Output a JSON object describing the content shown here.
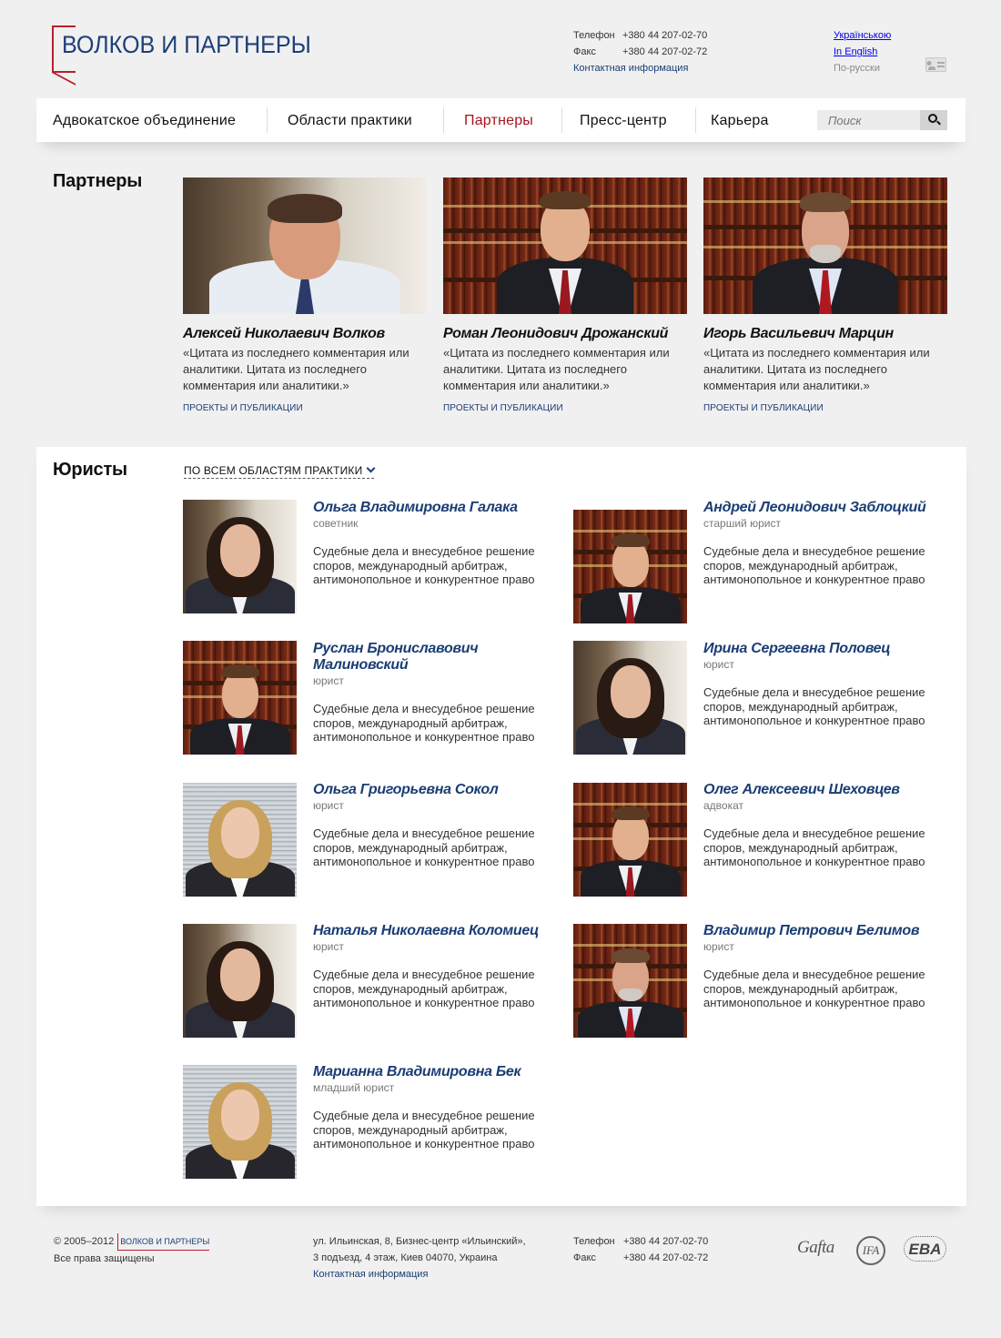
{
  "header": {
    "logo_text": "ВОЛКОВ И ПАРТНЕРЫ",
    "phone_label": "Телефон",
    "phone": "+380 44 207-02-70",
    "fax_label": "Факс",
    "fax": "+380 44 207-02-72",
    "contacts_link": "Контактная информация",
    "languages": [
      "Українською",
      "In English",
      "По-русски"
    ],
    "current_language": "По-русски"
  },
  "nav": {
    "items": [
      "Адвокатское объединение",
      "Области практики",
      "Партнеры",
      "Пресс-центр",
      "Карьера"
    ],
    "active": "Партнеры",
    "search_placeholder": "Поиск"
  },
  "partners": {
    "title": "Партнеры",
    "items": [
      {
        "name": "Алексей Николаевич Волков",
        "quote": "«Цитата из последнего комментария или аналитики. Цитата из последнего комментария или аналитики.»",
        "link": "ПРОЕКТЫ И ПУБЛИКАЦИИ"
      },
      {
        "name": "Роман Леонидович Дрожанский",
        "quote": "«Цитата из последнего комментария или аналитики. Цитата из последнего комментария или аналитики.»",
        "link": "ПРОЕКТЫ И ПУБЛИКАЦИИ"
      },
      {
        "name": "Игорь Васильевич Марцин",
        "quote": "«Цитата из последнего комментария или аналитики. Цитата из последнего комментария или аналитики.»",
        "link": "ПРОЕКТЫ И ПУБЛИКАЦИИ"
      }
    ]
  },
  "lawyers": {
    "title": "Юристы",
    "filter": "ПО ВСЕМ ОБЛАСТЯМ ПРАКТИКИ",
    "items": [
      {
        "name": "Ольга Владимировна Галака",
        "role": "советник",
        "desc": "Судебные дела и внесудебное решение споров, международный арбитраж, антимонопольное и конкурентное право"
      },
      {
        "name": "Андрей Леонидович Заблоцкий",
        "role": "старший юрист",
        "desc": "Судебные дела и внесудебное решение споров, международный арбитраж, антимонопольное и конкурентное право"
      },
      {
        "name": "Руслан Брониславович Малиновский",
        "role": "юрист",
        "desc": "Судебные дела и внесудебное решение споров, международный арбитраж, антимонопольное и конкурентное право"
      },
      {
        "name": "Ирина Сергеевна Половец",
        "role": "юрист",
        "desc": "Судебные дела и внесудебное решение споров, международный арбитраж, антимонопольное и конкурентное право"
      },
      {
        "name": "Ольга Григорьевна Сокол",
        "role": "юрист",
        "desc": "Судебные дела и внесудебное решение споров, международный арбитраж, антимонопольное и конкурентное право"
      },
      {
        "name": "Олег Алексеевич Шеховцев",
        "role": "адвокат",
        "desc": "Судебные дела и внесудебное решение споров, международный арбитраж, антимонопольное и конкурентное право"
      },
      {
        "name": "Наталья Николаевна Коломиец",
        "role": "юрист",
        "desc": "Судебные дела и внесудебное решение споров, международный арбитраж, антимонопольное и конкурентное право"
      },
      {
        "name": "Владимир Петрович Белимов",
        "role": "юрист",
        "desc": "Судебные дела и внесудебное решение споров, международный арбитраж, антимонопольное и конкурентное право"
      },
      {
        "name": "Марианна Владимировна Бек",
        "role": "младший юрист",
        "desc": "Судебные дела и внесудебное решение споров, международный арбитраж, антимонопольное и конкурентное право"
      }
    ]
  },
  "footer": {
    "copyright": "© 2005–2012",
    "logo_text": "ВОЛКОВ И ПАРТНЕРЫ",
    "rights": "Все права защищены",
    "address_line1": "ул. Ильинская, 8, Бизнес-центр «Ильинский»,",
    "address_line2": "3 подъезд, 4 этаж, Киев 04070, Украина",
    "contacts_link": "Контактная информация",
    "phone_label": "Телефон",
    "phone": "+380 44 207-02-70",
    "fax_label": "Факс",
    "fax": "+380 44 207-02-72",
    "associations": [
      "Gafta",
      "IFA",
      "EBA"
    ]
  },
  "colors": {
    "brand_red": "#b8202a",
    "brand_blue": "#1a3d74",
    "active_nav": "#a3151c"
  }
}
